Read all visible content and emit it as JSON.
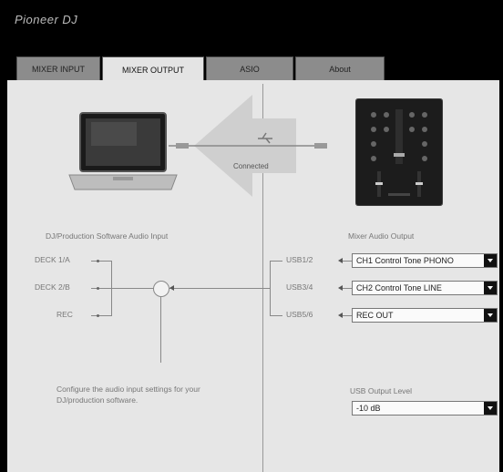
{
  "app": {
    "brand": "Pioneer DJ"
  },
  "tabs": [
    {
      "label": "MIXER INPUT",
      "active": false
    },
    {
      "label": "MIXER OUTPUT",
      "active": true
    },
    {
      "label": "ASIO",
      "active": false
    },
    {
      "label": "About",
      "active": false
    }
  ],
  "status": {
    "connected": "Connected"
  },
  "left": {
    "heading": "DJ/Production Software Audio Input",
    "inputs": [
      "DECK 1/A",
      "DECK 2/B",
      "REC"
    ],
    "configure_note_line1": "Configure the audio input settings for your",
    "configure_note_line2": "DJ/production software."
  },
  "right": {
    "heading": "Mixer Audio Output",
    "outputs": [
      {
        "channel": "USB1/2",
        "value": "CH1 Control Tone PHONO"
      },
      {
        "channel": "USB3/4",
        "value": "CH2 Control Tone LINE"
      },
      {
        "channel": "USB5/6",
        "value": "REC OUT"
      }
    ],
    "level_heading": "USB Output Level",
    "level_value": "-10 dB"
  },
  "colors": {
    "accent": "#000000",
    "panel": "#e6e6e6"
  }
}
